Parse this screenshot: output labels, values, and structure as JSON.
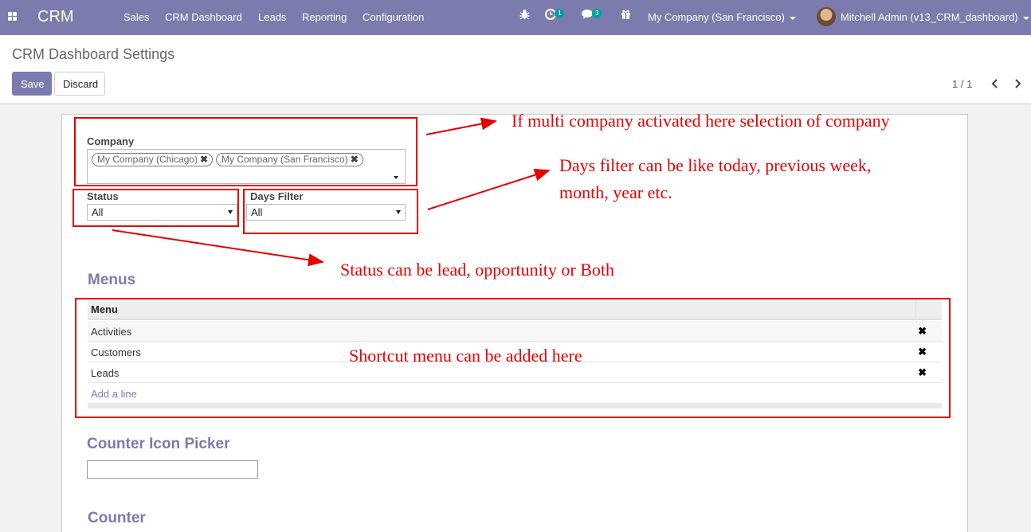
{
  "navbar": {
    "brand": "CRM",
    "menus": [
      "Sales",
      "CRM Dashboard",
      "Leads",
      "Reporting",
      "Configuration"
    ],
    "activity_count": "1",
    "message_count": "3",
    "company": "My Company (San Francisco)",
    "user": "Mitchell Admin (v13_CRM_dashboard)",
    "icons": [
      "apps-icon",
      "bug-icon",
      "clock-icon",
      "chat-icon",
      "gift-icon"
    ]
  },
  "control_panel": {
    "title": "CRM Dashboard Settings",
    "save_label": "Save",
    "discard_label": "Discard",
    "pager": "1 / 1"
  },
  "form": {
    "company_label": "Company",
    "company_tags": [
      "My Company (Chicago)",
      "My Company (San Francisco)"
    ],
    "status_label": "Status",
    "status_value": "All",
    "days_label": "Days Filter",
    "days_value": "All",
    "menus_title": "Menus",
    "menu_column": "Menu",
    "menu_rows": [
      "Activities",
      "Customers",
      "Leads"
    ],
    "add_line": "Add a line",
    "counter_icon_title": "Counter Icon Picker",
    "counter_title": "Counter"
  },
  "annotations": {
    "company_note": "If multi company activated here selection of company",
    "days_note_1": "Days filter can be like today, previous week,",
    "days_note_2": "month, year etc.",
    "status_note": "Status can be lead, opportunity or Both",
    "menu_note": "Shortcut menu can be added here"
  },
  "colors": {
    "brand": "#7c7bad",
    "annotation": "#e60000"
  }
}
